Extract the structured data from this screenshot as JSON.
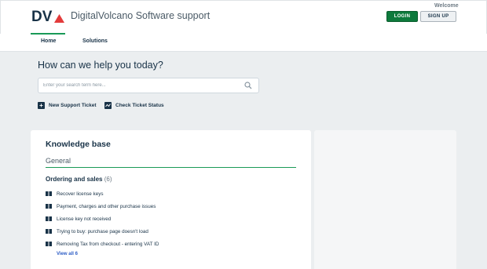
{
  "header": {
    "logo_text": "DV",
    "site_title": "DigitalVolcano Software support",
    "welcome": "Welcome",
    "login_label": "LOGIN",
    "signup_label": "SIGN UP"
  },
  "nav": {
    "tabs": [
      {
        "label": "Home",
        "active": true
      },
      {
        "label": "Solutions",
        "active": false
      }
    ]
  },
  "hero": {
    "title": "How can we help you today?",
    "search_placeholder": "Enter your search term here..."
  },
  "actions": [
    {
      "label": "New Support Ticket",
      "icon": "plus-icon"
    },
    {
      "label": "Check Ticket Status",
      "icon": "ticket-status-icon"
    }
  ],
  "knowledge_base": {
    "title": "Knowledge base",
    "category": "General",
    "folder": {
      "title": "Ordering and sales",
      "count": "(6)",
      "articles": [
        "Recover license keys",
        "Payment, charges and other purchase issues",
        "License key not received",
        "Trying to buy: purchase page doesn't load",
        "Removing Tax from checkout - entering VAT ID"
      ],
      "view_all": "View all 6"
    }
  },
  "colors": {
    "accent_green": "#1a9a57",
    "login_green": "#0e7a3c",
    "text_dark": "#183247",
    "link_blue": "#2c5cc5",
    "logo_red": "#e33b3b"
  }
}
